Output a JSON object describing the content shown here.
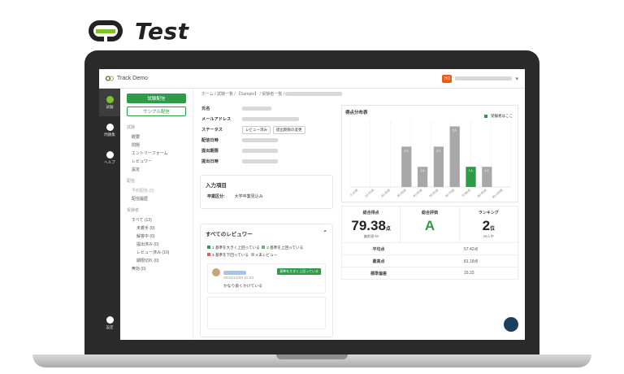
{
  "brand": {
    "name": "Test"
  },
  "app": {
    "title": "Track Demo",
    "user_initials": "HO"
  },
  "sidebar": {
    "items": [
      {
        "label": "試験",
        "icon": "exam-icon"
      },
      {
        "label": "問題集",
        "icon": "book-icon"
      },
      {
        "label": "ヘルプ",
        "icon": "help-icon"
      }
    ],
    "bottom": {
      "label": "設定",
      "icon": "gear-icon"
    }
  },
  "breadcrumb": "ホーム / 試験一覧 / 【Sample】 / 受験者一覧 /",
  "nav": {
    "primary_button": "試験配信",
    "secondary_button": "サンプル配信",
    "sections": [
      {
        "title": "試験",
        "items": [
          "概要",
          "問題",
          "エントリーフォーム",
          "レビュワー",
          "設定"
        ]
      },
      {
        "title": "配信",
        "items": [
          "予約配信 (0)",
          "配信履歴"
        ]
      },
      {
        "title": "受験者",
        "items": [
          "すべて (13)",
          "未着手 (0)",
          "解答中 (0)",
          "提出済み (0)",
          "レビュー済み (10)",
          "期限切れ (0)",
          "無効 (0)"
        ]
      }
    ]
  },
  "detail": {
    "labels": [
      "氏名",
      "メールアドレス",
      "ステータス",
      "配信日時",
      "提出期限",
      "提出日時"
    ],
    "status_tags": [
      "レビュー済み",
      "提出期限の変更"
    ]
  },
  "input_card": {
    "title": "入力項目",
    "key": "卒業区分:",
    "value": "大学卒業見込み"
  },
  "reviews": {
    "title": "すべてのレビュワー",
    "legend": [
      "1 基準を大きく上回っている",
      "2 基準を上回っている",
      "3 基準を下回っている",
      "4 未レビュー"
    ],
    "entry": {
      "date": "2022/12/06 11:53",
      "comment": "かなり良くかけている",
      "tag": "基準を大きく上回っている"
    }
  },
  "chart": {
    "title": "得点分布表",
    "legend": "受験者はここ"
  },
  "stats": {
    "total": {
      "label": "総合得点",
      "value": "79.38",
      "unit": "点",
      "sub": "偏差値 64"
    },
    "grade": {
      "label": "総合評価",
      "value": "A"
    },
    "rank": {
      "label": "ランキング",
      "value": "2",
      "unit": "位",
      "sub": "16人中"
    },
    "rows": [
      {
        "k": "平均点",
        "v": "57.42点"
      },
      {
        "k": "最高点",
        "v": "81.18点"
      },
      {
        "k": "標準偏差",
        "v": "15.33"
      }
    ]
  },
  "chart_data": {
    "type": "bar",
    "categories": [
      "0-10点",
      "10-20点",
      "20-30点",
      "30-40点",
      "40-50点",
      "50-60点",
      "60-70点",
      "70-80点",
      "80-90点",
      "90-100点"
    ],
    "values": [
      0,
      0,
      0,
      2,
      1,
      2,
      3,
      1,
      1,
      0
    ],
    "bar_labels": [
      "",
      "",
      "",
      "2人",
      "1人",
      "2人",
      "3人",
      "1人",
      "1人",
      ""
    ],
    "highlight_index": 7,
    "colors": {
      "normal": "#a8a8a8",
      "highlight": "#2e9c47"
    }
  }
}
